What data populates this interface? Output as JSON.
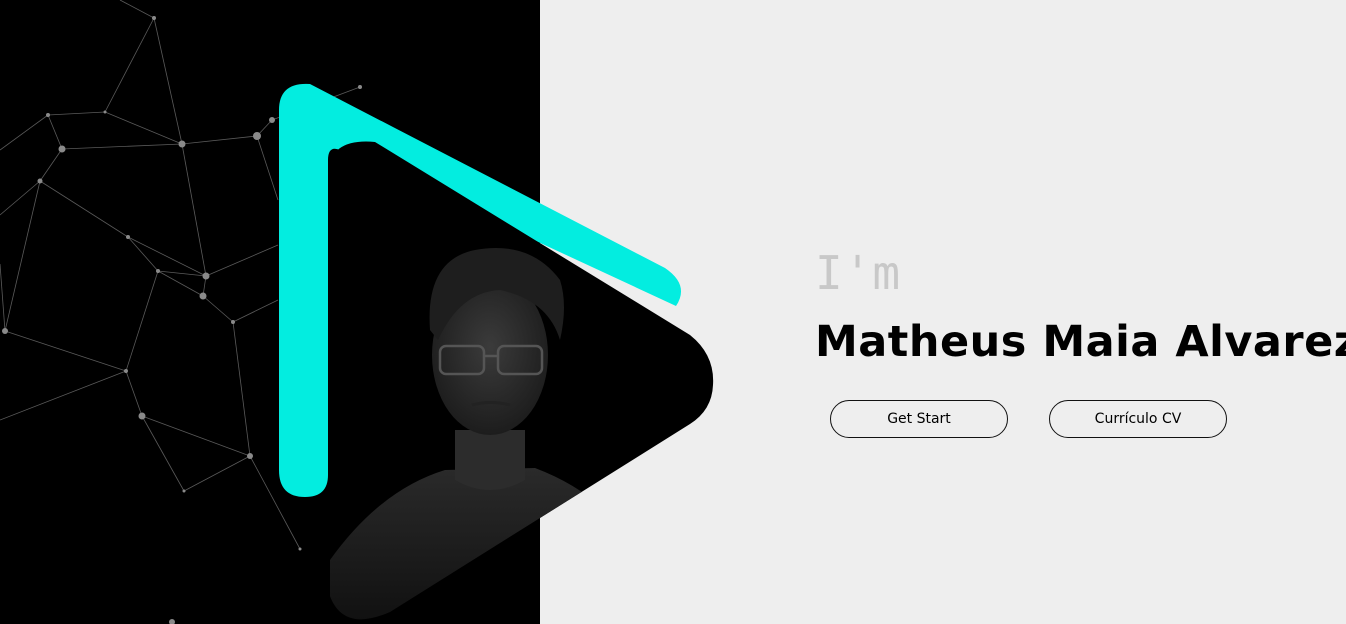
{
  "hero": {
    "intro": "I'm",
    "name": "Matheus Maia Alvarez"
  },
  "buttons": {
    "get_start": "Get Start",
    "curriculo": "Currículo CV"
  },
  "colors": {
    "left_background": "#000000",
    "right_background": "#eeeeee",
    "accent": "#03ede0",
    "intro_text": "#c8c8c8",
    "name_text": "#000000"
  },
  "icons": {
    "play_shape": "play-triangle-icon",
    "background_pattern": "network-pattern"
  }
}
